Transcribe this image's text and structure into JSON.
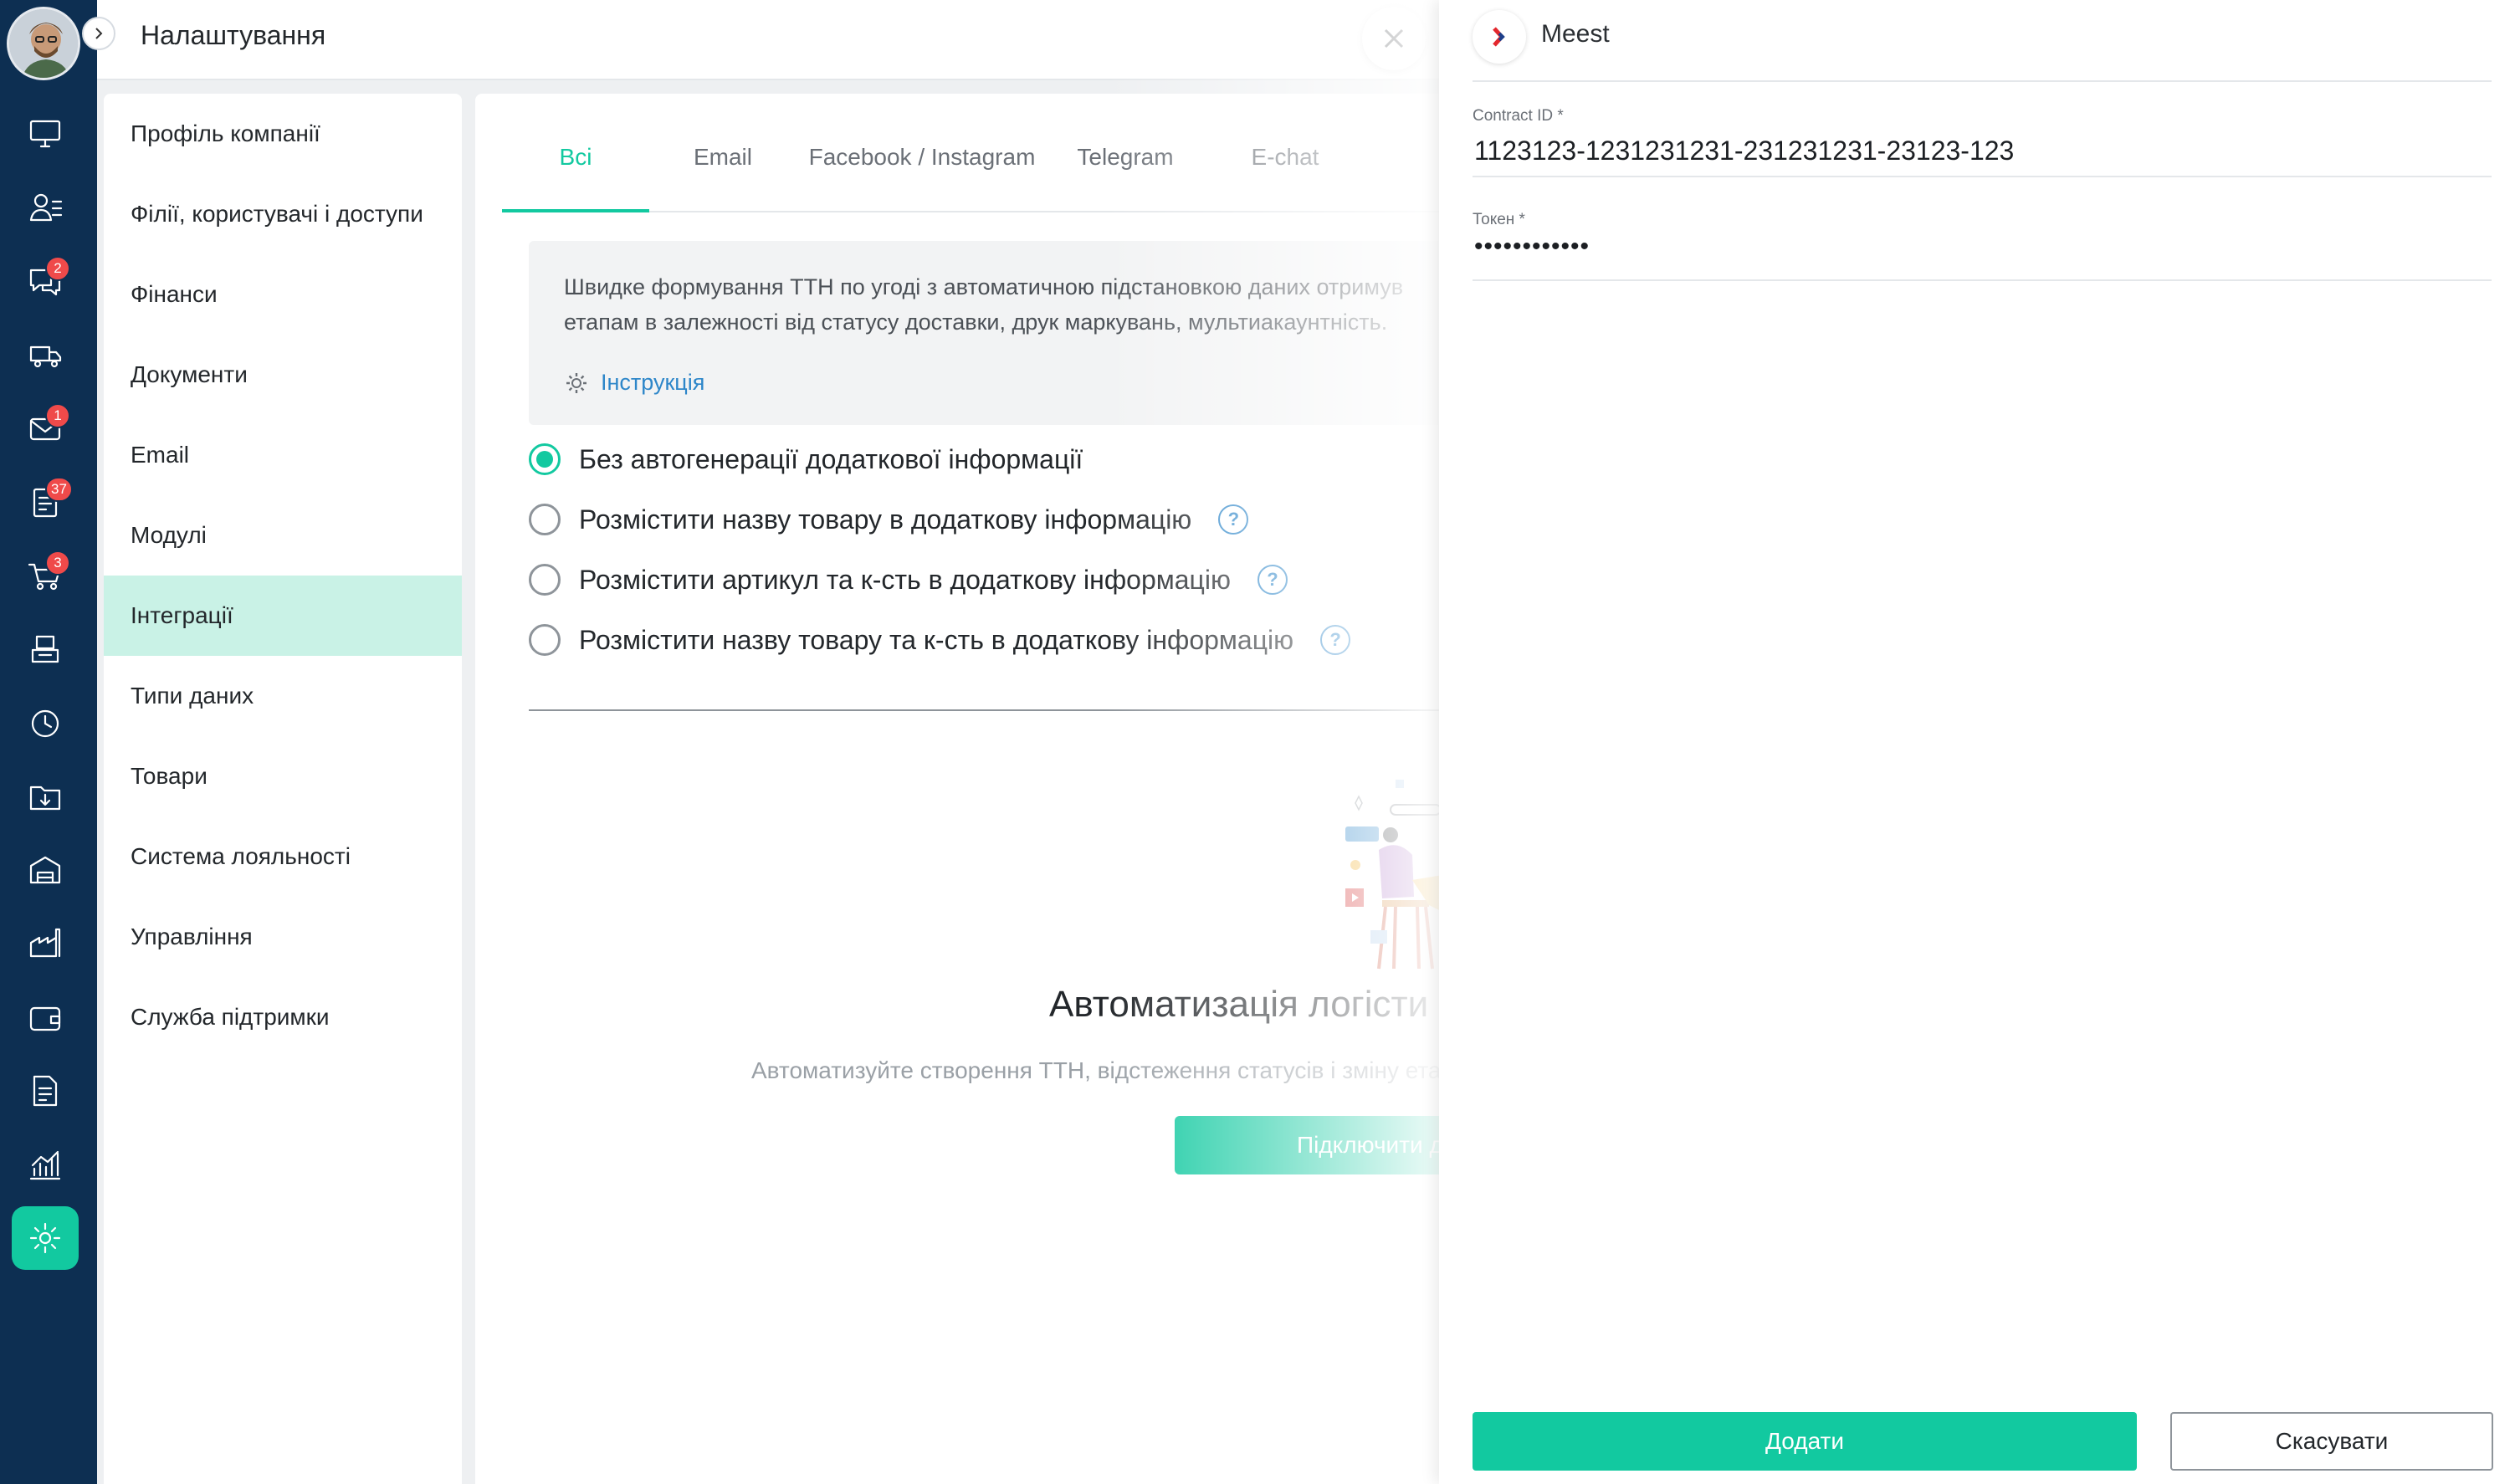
{
  "topbar": {
    "title": "Налаштування"
  },
  "rail": {
    "items": [
      {
        "icon": "monitor-icon"
      },
      {
        "icon": "contacts-icon"
      },
      {
        "icon": "chat-icon",
        "badge": "2"
      },
      {
        "icon": "delivery-truck-icon"
      },
      {
        "icon": "mail-icon",
        "badge": "1"
      },
      {
        "icon": "tasks-icon",
        "badge": "37"
      },
      {
        "icon": "cart-icon",
        "badge": "3"
      },
      {
        "icon": "cash-register-icon"
      },
      {
        "icon": "clock-icon"
      },
      {
        "icon": "folder-download-icon"
      },
      {
        "icon": "warehouse-icon"
      },
      {
        "icon": "factory-icon"
      },
      {
        "icon": "wallet-icon"
      },
      {
        "icon": "report-icon"
      },
      {
        "icon": "analytics-icon"
      },
      {
        "icon": "settings-icon"
      }
    ]
  },
  "menu": {
    "items": [
      "Профіль компанії",
      "Філії, користувачі і доступи",
      "Фінанси",
      "Документи",
      "Email",
      "Модулі",
      "Інтеграції",
      "Типи даних",
      "Товари",
      "Система лояльності",
      "Управління",
      "Служба підтримки"
    ],
    "active": "Інтеграції"
  },
  "tabs": [
    "Всі",
    "Email",
    "Facebook / Instagram",
    "Telegram",
    "E-chat"
  ],
  "info": {
    "text": "Швидке формування ТТН по угоді з автоматичною підстановкою даних отримув\nетапам в залежності від статусу доставки, друк маркувань, мультиакаунтність.",
    "link": "Інструкція"
  },
  "options": [
    {
      "label": "Без автогенерації додаткової інформації",
      "checked": true,
      "help": false
    },
    {
      "label": "Розмістити назву товару в додаткову інформацію",
      "checked": false,
      "help": true
    },
    {
      "label": "Розмістити артикул та к-сть в додаткову інформацію",
      "checked": false,
      "help": true
    },
    {
      "label": "Розмістити назву товару та к-сть в додаткову інформацію",
      "checked": false,
      "help": true
    }
  ],
  "help_glyph": "?",
  "promo": {
    "title": "Автоматизація логісти",
    "subtitle": "Автоматизуйте створення ТТН, відстеження статусів і зміну ета",
    "button": "Підключити д"
  },
  "drawer": {
    "title": "Meest",
    "fields": [
      {
        "label": "Contract ID *",
        "value": "1123123-1231231231-231231231-23123-123"
      },
      {
        "label": "Токен *",
        "value": "••••••••••••"
      }
    ],
    "submit": "Додати",
    "cancel": "Скасувати"
  },
  "colors": {
    "accent": "#12c9a0",
    "rail": "#0d2f52",
    "badge": "#ef4a4a",
    "link": "#2d86c9",
    "active_menu": "#c9f2e6",
    "brand_red": "#e3272d"
  }
}
